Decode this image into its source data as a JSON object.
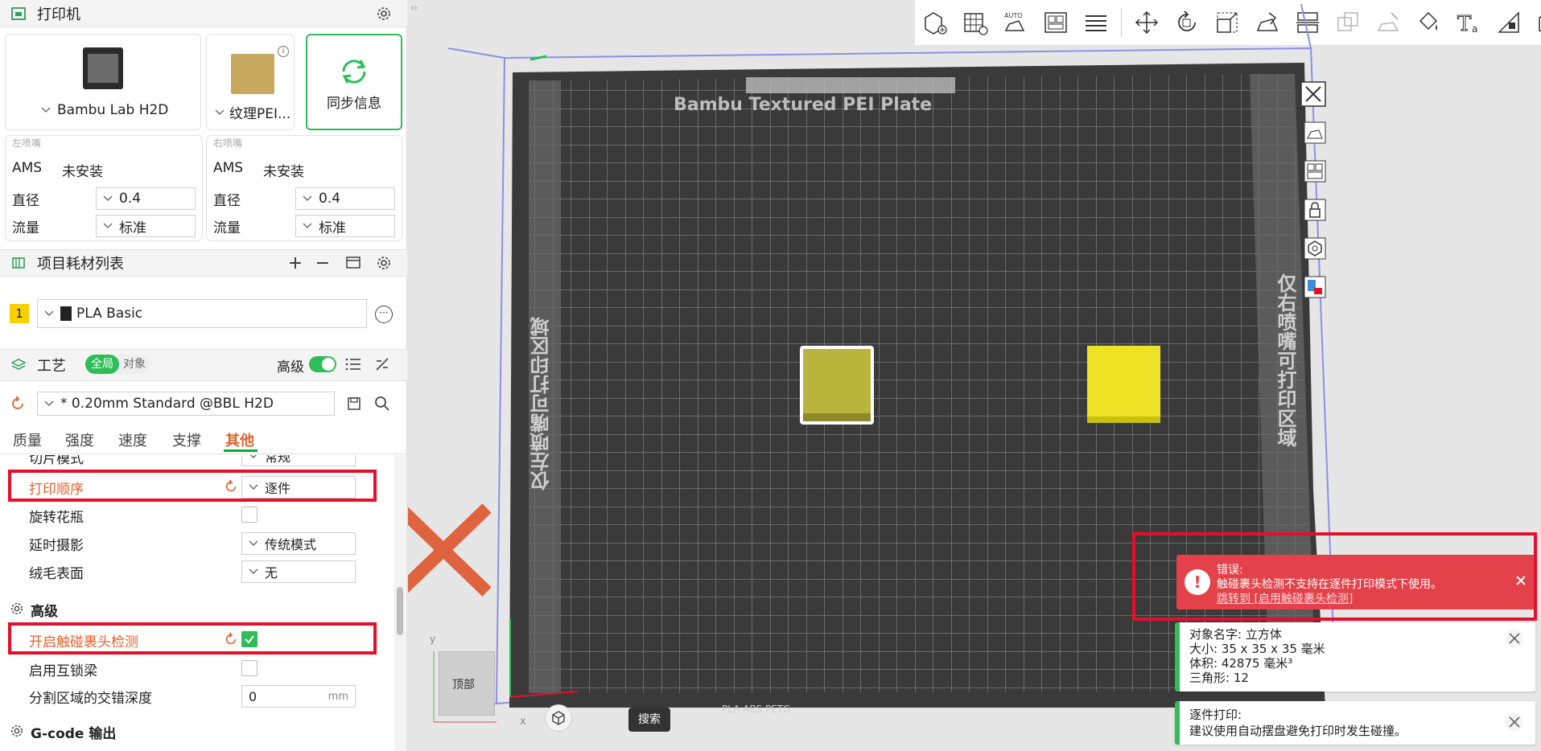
{
  "printer": {
    "title": "打印机",
    "model": "Bambu Lab H2D",
    "plate": "纹理PEI...",
    "sync": "同步信息",
    "left_nozzle": {
      "title": "左喷嘴",
      "ams_label": "AMS",
      "ams_value": "未安装",
      "diameter_label": "直径",
      "diameter": "0.4",
      "flow_label": "流量",
      "flow": "标准"
    },
    "right_nozzle": {
      "title": "右喷嘴",
      "ams_label": "AMS",
      "ams_value": "未安装",
      "diameter_label": "直径",
      "diameter": "0.4",
      "flow_label": "流量",
      "flow": "标准"
    }
  },
  "filament": {
    "title": "项目耗材列表",
    "items": [
      {
        "index": "1",
        "name": "PLA Basic",
        "color": "#f7d000"
      }
    ]
  },
  "process": {
    "title": "工艺",
    "toggle_global": "全局",
    "toggle_object": "对象",
    "advanced_label": "高级",
    "preset": "* 0.20mm Standard @BBL H2D",
    "tabs": [
      "质量",
      "强度",
      "速度",
      "支撑",
      "其他"
    ],
    "active_tab": "其他",
    "options": {
      "slice_mode_label": "切片模式",
      "slice_mode_value": "常规",
      "print_sequence_label": "打印顺序",
      "print_sequence_value": "逐件",
      "spiral_vase_label": "旋转花瓶",
      "timelapse_label": "延时摄影",
      "timelapse_value": "传统模式",
      "fuzzy_skin_label": "绒毛表面",
      "fuzzy_skin_value": "无",
      "advanced_heading": "高级",
      "collision_detect_label": "开启触碰裹头检测",
      "interlock_label": "启用互锁梁",
      "interlock_depth_label": "分割区域的交错深度",
      "interlock_depth_value": "0",
      "interlock_depth_unit": "mm",
      "gcode_heading": "G-code 输出"
    }
  },
  "viewport": {
    "plate_title": "Bambu Textured PEI Plate",
    "left_zone": "仅左喷嘴可打印区域",
    "right_zone": "仅右喷嘴可打印区域",
    "bottom_label": "PLA ABS PETG",
    "view_cube": "顶部",
    "axis_x": "x",
    "axis_y": "y",
    "search": "搜索",
    "cube_left_color": "#b9b43c",
    "cube_right_color": "#ede224"
  },
  "error": {
    "title": "错误:",
    "message": "触碰裹头检测不支持在逐件打印模式下使用。",
    "link": "跳转到 [启用触碰裹头检测]"
  },
  "info": {
    "name_line": "对象名字:  立方体",
    "size_line": "大小:   35 x 35 x 35 毫米",
    "volume_line": "体积:   42875 毫米³",
    "tri_line": "三角形:  12"
  },
  "tip": {
    "title": "逐件打印:",
    "message": "建议使用自动摆盘避免打印时发生碰撞。"
  }
}
